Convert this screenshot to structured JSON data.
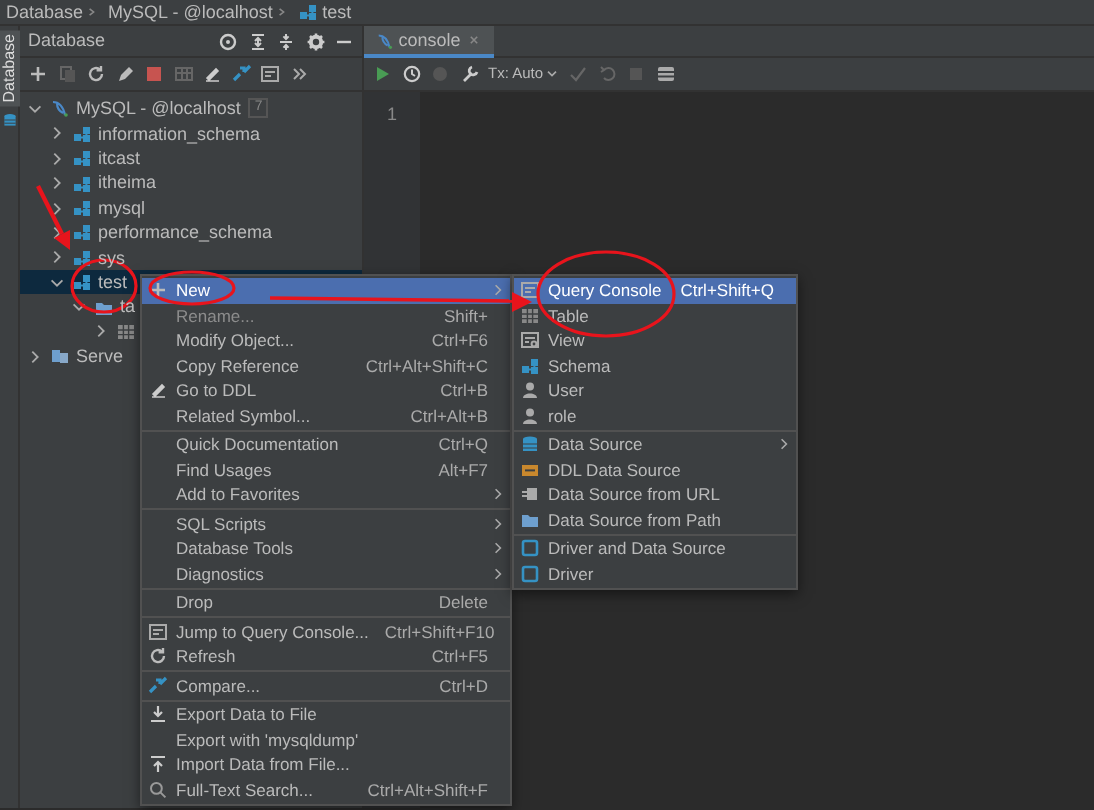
{
  "breadcrumb": [
    {
      "label": "Database"
    },
    {
      "label": "MySQL - @localhost"
    },
    {
      "label": "test"
    }
  ],
  "side_strip": {
    "label": "Database"
  },
  "database_panel": {
    "title": "Database",
    "tree": [
      {
        "label": "MySQL - @localhost",
        "count": "7",
        "kind": "connection",
        "expanded": true,
        "selected": false,
        "children": [
          {
            "label": "information_schema",
            "kind": "schema",
            "expanded": false,
            "selected": false
          },
          {
            "label": "itcast",
            "kind": "schema",
            "expanded": false,
            "selected": false
          },
          {
            "label": "itheima",
            "kind": "schema",
            "expanded": false,
            "selected": false
          },
          {
            "label": "mysql",
            "kind": "schema",
            "expanded": false,
            "selected": false
          },
          {
            "label": "performance_schema",
            "kind": "schema",
            "expanded": false,
            "selected": false
          },
          {
            "label": "sys",
            "kind": "schema",
            "expanded": false,
            "selected": false
          },
          {
            "label": "test",
            "kind": "schema",
            "expanded": true,
            "selected": true,
            "children": [
              {
                "label": "ta",
                "kind": "folder",
                "expanded": true,
                "selected": false,
                "children": [
                  {
                    "kind": "table",
                    "expanded": false,
                    "selected": false
                  }
                ]
              }
            ]
          }
        ]
      },
      {
        "label": "Serve",
        "kind": "server",
        "expanded": false,
        "selected": false
      }
    ]
  },
  "editor": {
    "tabs": [
      {
        "label": "console",
        "selected": true
      }
    ],
    "tx_mode": "Tx: Auto",
    "line_numbers": [
      "1"
    ]
  },
  "context_menu": {
    "groups": [
      [
        {
          "label": "New",
          "selected": true,
          "disabled": false,
          "has_submenu": true
        },
        {
          "label": "Rename...",
          "shortcut": "Shift+",
          "selected": false,
          "disabled": true,
          "has_submenu": false
        },
        {
          "label": "Modify Object...",
          "shortcut": "Ctrl+F6",
          "selected": false,
          "disabled": false,
          "has_submenu": false
        },
        {
          "label": "Copy Reference",
          "shortcut": "Ctrl+Alt+Shift+C",
          "selected": false,
          "disabled": false,
          "has_submenu": false
        },
        {
          "label": "Go to DDL",
          "shortcut": "Ctrl+B",
          "selected": false,
          "disabled": false,
          "has_submenu": false
        },
        {
          "label": "Related Symbol...",
          "shortcut": "Ctrl+Alt+B",
          "selected": false,
          "disabled": false,
          "has_submenu": false
        }
      ],
      [
        {
          "label": "Quick Documentation",
          "shortcut": "Ctrl+Q",
          "selected": false,
          "disabled": false,
          "has_submenu": false
        },
        {
          "label": "Find Usages",
          "shortcut": "Alt+F7",
          "selected": false,
          "disabled": false,
          "has_submenu": false
        },
        {
          "label": "Add to Favorites",
          "selected": false,
          "disabled": false,
          "has_submenu": true
        }
      ],
      [
        {
          "label": "SQL Scripts",
          "selected": false,
          "disabled": false,
          "has_submenu": true
        },
        {
          "label": "Database Tools",
          "selected": false,
          "disabled": false,
          "has_submenu": true
        },
        {
          "label": "Diagnostics",
          "selected": false,
          "disabled": false,
          "has_submenu": true
        }
      ],
      [
        {
          "label": "Drop",
          "shortcut": "Delete",
          "selected": false,
          "disabled": false,
          "has_submenu": false
        }
      ],
      [
        {
          "label": "Jump to Query Console...",
          "shortcut": "Ctrl+Shift+F10",
          "selected": false,
          "disabled": false,
          "has_submenu": false
        },
        {
          "label": "Refresh",
          "shortcut": "Ctrl+F5",
          "selected": false,
          "disabled": false,
          "has_submenu": false
        }
      ],
      [
        {
          "label": "Compare...",
          "shortcut": "Ctrl+D",
          "selected": false,
          "disabled": false,
          "has_submenu": false
        }
      ],
      [
        {
          "label": "Export Data to File",
          "selected": false,
          "disabled": false,
          "has_submenu": false
        },
        {
          "label": "Export with 'mysqldump'",
          "selected": false,
          "disabled": false,
          "has_submenu": false
        },
        {
          "label": "Import Data from File...",
          "selected": false,
          "disabled": false,
          "has_submenu": false
        },
        {
          "label": "Full-Text Search...",
          "shortcut": "Ctrl+Alt+Shift+F",
          "selected": false,
          "disabled": false,
          "has_submenu": false
        }
      ]
    ]
  },
  "submenu": {
    "groups": [
      [
        {
          "label": "Query Console",
          "shortcut": "Ctrl+Shift+Q",
          "selected": true,
          "disabled": false,
          "has_submenu": false
        },
        {
          "label": "Table",
          "selected": false,
          "disabled": false,
          "has_submenu": false
        },
        {
          "label": "View",
          "selected": false,
          "disabled": false,
          "has_submenu": false
        },
        {
          "label": "Schema",
          "selected": false,
          "disabled": false,
          "has_submenu": false
        },
        {
          "label": "User",
          "selected": false,
          "disabled": false,
          "has_submenu": false
        },
        {
          "label": "role",
          "selected": false,
          "disabled": false,
          "has_submenu": false
        }
      ],
      [
        {
          "label": "Data Source",
          "selected": false,
          "disabled": false,
          "has_submenu": true
        },
        {
          "label": "DDL Data Source",
          "selected": false,
          "disabled": false,
          "has_submenu": false
        },
        {
          "label": "Data Source from URL",
          "selected": false,
          "disabled": false,
          "has_submenu": false
        },
        {
          "label": "Data Source from Path",
          "selected": false,
          "disabled": false,
          "has_submenu": false
        }
      ],
      [
        {
          "label": "Driver and Data Source",
          "selected": false,
          "disabled": false,
          "has_submenu": false
        },
        {
          "label": "Driver",
          "selected": false,
          "disabled": false,
          "has_submenu": false
        }
      ]
    ]
  }
}
